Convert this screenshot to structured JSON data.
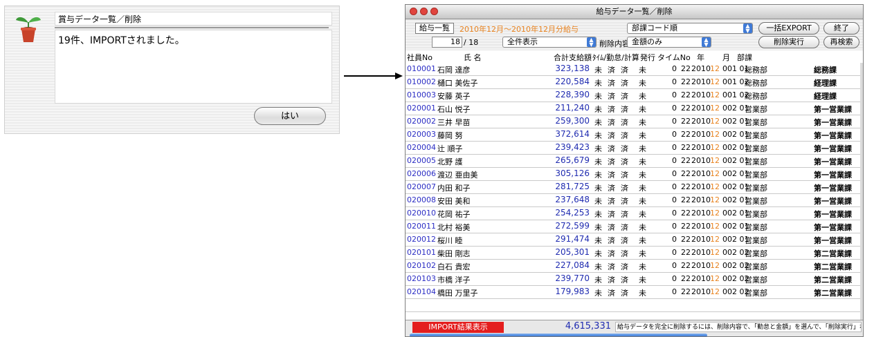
{
  "dialog": {
    "title": "賞与データ一覧／削除",
    "message": "19件、IMPORTされました。",
    "ok_label": "はい"
  },
  "window": {
    "title": "給与データ一覧／削除",
    "kyuyo_button": "給与一覧",
    "period_text": "2010年12月〜2010年12月分給与",
    "sort_select": "部課コード順",
    "export_button": "一括EXPORT",
    "exit_button": "終了",
    "record_count": "18",
    "record_total": "/ 18",
    "filter_select": "全件表示",
    "delete_content_label": "削除内容",
    "delete_content_select": "金額のみ",
    "delete_button": "削除実行",
    "research_button": "再検索"
  },
  "columns": {
    "emp_no": "社員No",
    "name": "氏 名",
    "total": "合計支給額",
    "time_status": "ﾀｲﾑ/勤怠/計算",
    "issue": "発行",
    "time_no": "タイムNo",
    "year": "年",
    "month": "月",
    "dept": "部課"
  },
  "rows": [
    {
      "id": "010001",
      "name": "石岡 達彦",
      "amount": "323,138",
      "s1": "未",
      "s2": "済",
      "s3": "済",
      "s4": "未",
      "zero": "0",
      "tno": "22",
      "year": "2010",
      "month": "12",
      "dept": "001 01",
      "dname": "総務部",
      "kname": "総務課"
    },
    {
      "id": "010002",
      "name": "樋口 美佐子",
      "amount": "220,584",
      "s1": "未",
      "s2": "済",
      "s3": "済",
      "s4": "未",
      "zero": "0",
      "tno": "22",
      "year": "2010",
      "month": "12",
      "dept": "001 02",
      "dname": "総務部",
      "kname": "経理課"
    },
    {
      "id": "010003",
      "name": "安藤 英子",
      "amount": "228,390",
      "s1": "未",
      "s2": "済",
      "s3": "済",
      "s4": "未",
      "zero": "0",
      "tno": "22",
      "year": "2010",
      "month": "12",
      "dept": "001 02",
      "dname": "総務部",
      "kname": "経理課"
    },
    {
      "id": "020001",
      "name": "石山 悦子",
      "amount": "211,240",
      "s1": "未",
      "s2": "済",
      "s3": "済",
      "s4": "未",
      "zero": "0",
      "tno": "22",
      "year": "2010",
      "month": "12",
      "dept": "002 01",
      "dname": "営業部",
      "kname": "第一営業課"
    },
    {
      "id": "020002",
      "name": "三井 早苗",
      "amount": "259,300",
      "s1": "未",
      "s2": "済",
      "s3": "済",
      "s4": "未",
      "zero": "0",
      "tno": "22",
      "year": "2010",
      "month": "12",
      "dept": "002 01",
      "dname": "営業部",
      "kname": "第一営業課"
    },
    {
      "id": "020003",
      "name": "藤岡 努",
      "amount": "372,614",
      "s1": "未",
      "s2": "済",
      "s3": "済",
      "s4": "未",
      "zero": "0",
      "tno": "22",
      "year": "2010",
      "month": "12",
      "dept": "002 01",
      "dname": "営業部",
      "kname": "第一営業課"
    },
    {
      "id": "020004",
      "name": "辻 順子",
      "amount": "239,423",
      "s1": "未",
      "s2": "済",
      "s3": "済",
      "s4": "未",
      "zero": "0",
      "tno": "22",
      "year": "2010",
      "month": "12",
      "dept": "002 01",
      "dname": "営業部",
      "kname": "第一営業課"
    },
    {
      "id": "020005",
      "name": "北野 護",
      "amount": "265,679",
      "s1": "未",
      "s2": "済",
      "s3": "済",
      "s4": "未",
      "zero": "0",
      "tno": "22",
      "year": "2010",
      "month": "12",
      "dept": "002 01",
      "dname": "営業部",
      "kname": "第一営業課"
    },
    {
      "id": "020006",
      "name": "渡辺 亜由美",
      "amount": "305,126",
      "s1": "未",
      "s2": "済",
      "s3": "済",
      "s4": "未",
      "zero": "0",
      "tno": "22",
      "year": "2010",
      "month": "12",
      "dept": "002 01",
      "dname": "営業部",
      "kname": "第一営業課"
    },
    {
      "id": "020007",
      "name": "内田 和子",
      "amount": "281,725",
      "s1": "未",
      "s2": "済",
      "s3": "済",
      "s4": "未",
      "zero": "0",
      "tno": "22",
      "year": "2010",
      "month": "12",
      "dept": "002 01",
      "dname": "営業部",
      "kname": "第一営業課"
    },
    {
      "id": "020008",
      "name": "安田 美和",
      "amount": "237,648",
      "s1": "未",
      "s2": "済",
      "s3": "済",
      "s4": "未",
      "zero": "0",
      "tno": "22",
      "year": "2010",
      "month": "12",
      "dept": "002 01",
      "dname": "営業部",
      "kname": "第一営業課"
    },
    {
      "id": "020010",
      "name": "花岡 祐子",
      "amount": "254,253",
      "s1": "未",
      "s2": "済",
      "s3": "済",
      "s4": "未",
      "zero": "0",
      "tno": "22",
      "year": "2010",
      "month": "12",
      "dept": "002 01",
      "dname": "営業部",
      "kname": "第一営業課"
    },
    {
      "id": "020011",
      "name": "北村 裕美",
      "amount": "272,599",
      "s1": "未",
      "s2": "済",
      "s3": "済",
      "s4": "未",
      "zero": "0",
      "tno": "22",
      "year": "2010",
      "month": "12",
      "dept": "002 01",
      "dname": "営業部",
      "kname": "第一営業課"
    },
    {
      "id": "020012",
      "name": "桜川 睦",
      "amount": "291,474",
      "s1": "未",
      "s2": "済",
      "s3": "済",
      "s4": "未",
      "zero": "0",
      "tno": "22",
      "year": "2010",
      "month": "12",
      "dept": "002 01",
      "dname": "営業部",
      "kname": "第一営業課"
    },
    {
      "id": "020101",
      "name": "柴田 剛志",
      "amount": "205,301",
      "s1": "未",
      "s2": "済",
      "s3": "済",
      "s4": "未",
      "zero": "0",
      "tno": "22",
      "year": "2010",
      "month": "12",
      "dept": "002 02",
      "dname": "営業部",
      "kname": "第二営業課"
    },
    {
      "id": "020102",
      "name": "白石 貴宏",
      "amount": "227,084",
      "s1": "未",
      "s2": "済",
      "s3": "済",
      "s4": "未",
      "zero": "0",
      "tno": "22",
      "year": "2010",
      "month": "12",
      "dept": "002 02",
      "dname": "営業部",
      "kname": "第二営業課"
    },
    {
      "id": "020103",
      "name": "市橋 洋子",
      "amount": "239,770",
      "s1": "未",
      "s2": "済",
      "s3": "済",
      "s4": "未",
      "zero": "0",
      "tno": "22",
      "year": "2010",
      "month": "12",
      "dept": "002 02",
      "dname": "営業部",
      "kname": "第二営業課"
    },
    {
      "id": "020104",
      "name": "橋田 万里子",
      "amount": "179,983",
      "s1": "未",
      "s2": "済",
      "s3": "済",
      "s4": "未",
      "zero": "0",
      "tno": "22",
      "year": "2010",
      "month": "12",
      "dept": "002 02",
      "dname": "営業部",
      "kname": "第二営業課"
    }
  ],
  "footer": {
    "import_result_button": "IMPORT結果表示",
    "total": "4,615,331",
    "note": "給与データを完全に削除するには、削除内容で、「勤怠と金額」を選んで、「削除実行」ボタンを押します。"
  },
  "colors": {
    "accent_red": "#e41e1e",
    "period_orange": "#e8821e",
    "id_blue": "#2b2dc4",
    "amount_blue": "#1f2bb0"
  },
  "icons": [
    "sprout-pot-icon",
    "arrow-right-icon",
    "close-light-icon",
    "minimize-light-icon",
    "zoom-light-icon",
    "popup-arrows-icon"
  ]
}
